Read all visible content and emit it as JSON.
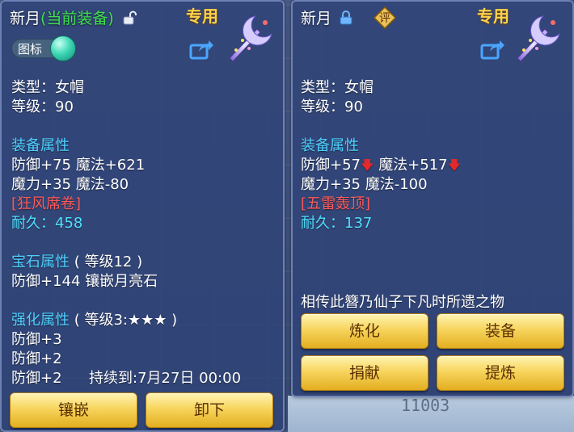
{
  "background": {
    "bottom_number": "11003"
  },
  "left_panel": {
    "title_name": "新月",
    "title_status": "(当前装备)",
    "exclusive_label": "专用",
    "toggle_label": "图标",
    "type_line": "类型：女帽",
    "level_line": "等级：90",
    "equip_attr_heading": "装备属性",
    "attr_line1": "防御+75 魔法+621",
    "attr_line2": "魔力+35 魔法-80",
    "special_name": "[狂风席卷]",
    "durability": "耐久：458",
    "gem_heading": "宝石属性",
    "gem_level": "( 等级12 )",
    "gem_line": "防御+144 镶嵌月亮石",
    "enhance_heading": "强化属性",
    "enhance_level": "( 等级3:★★★ )",
    "enhance_line1": "防御+3",
    "enhance_line2": "防御+2",
    "enhance_line3": "防御+2",
    "duration_line": "持续到:7月27日 00:00",
    "buttons": {
      "inlay": "镶嵌",
      "unequip": "卸下"
    }
  },
  "right_panel": {
    "title_name": "新月",
    "rating_badge": "评",
    "exclusive_label": "专用",
    "type_line": "类型：女帽",
    "level_line": "等级：90",
    "equip_attr_heading": "装备属性",
    "attr1_part1": "防御+57",
    "attr1_part2": "魔法+517",
    "attr_line2": "魔力+35 魔法-100",
    "special_name": "[五雷轰顶]",
    "durability": "耐久：137",
    "description": "相传此簪乃仙子下凡时所遗之物",
    "buttons": {
      "refine": "炼化",
      "equip": "装备",
      "donate": "捐献",
      "extract": "提炼"
    }
  },
  "colors": {
    "panel_bg": "#2e4276",
    "heading_blue": "#4fd0ff",
    "special_red": "#ff5a5a",
    "durability_cyan": "#52e0ff",
    "button_gold": "#f7d55e",
    "status_green": "#3ee24a",
    "exclusive_gold": "#ffd34a"
  },
  "icons": [
    "lock-open-icon",
    "lock-icon",
    "share-icon",
    "hairpin-weapon-icon",
    "arrow-down-icon"
  ]
}
